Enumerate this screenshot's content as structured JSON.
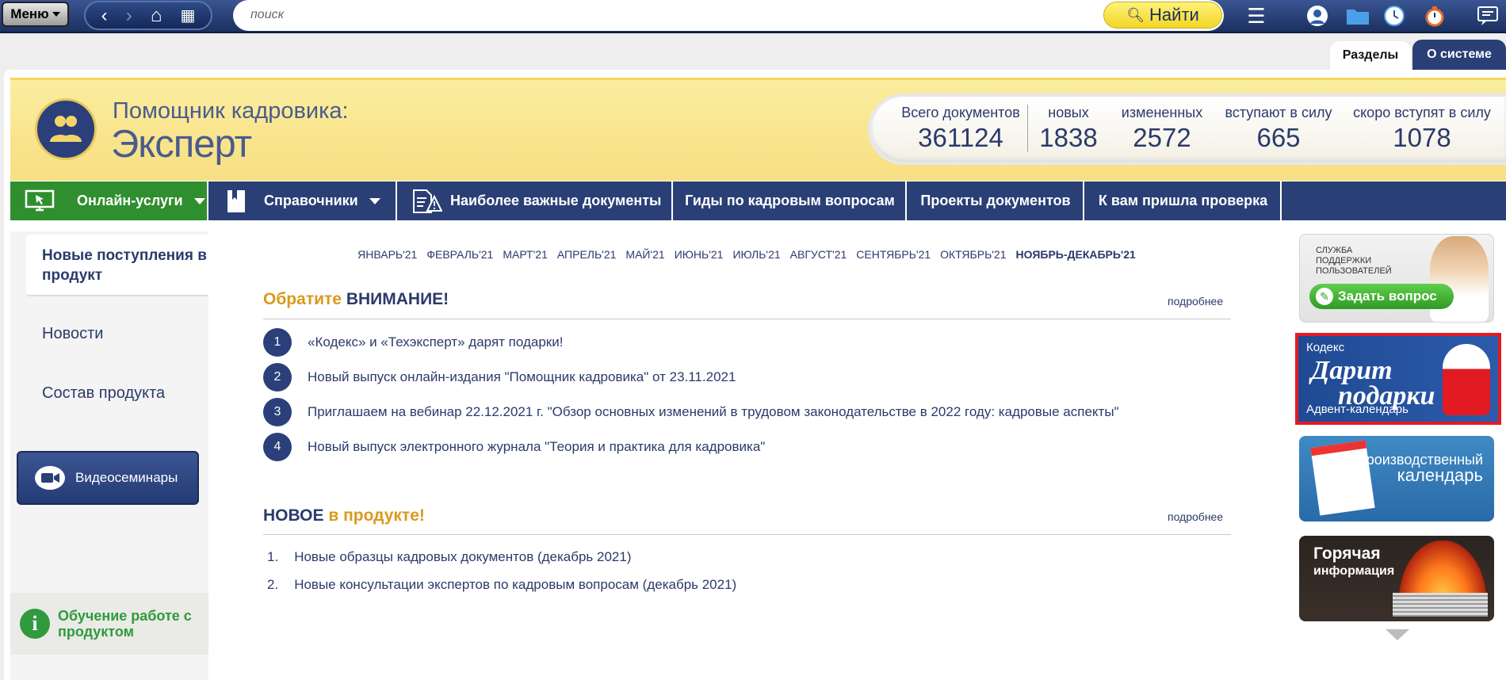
{
  "toolbar": {
    "menu_label": "Меню",
    "search_placeholder": "поиск",
    "find_label": "Найти",
    "icons": [
      "back-icon",
      "forward-icon",
      "home-icon",
      "grid-icon",
      "hamburger-icon",
      "user-icon",
      "folder-icon",
      "clock-icon",
      "stopwatch-icon",
      "comment-icon"
    ]
  },
  "tabs": {
    "sections": "Разделы",
    "about": "О системе"
  },
  "banner": {
    "title_line1": "Помощник кадровика:",
    "title_line2": "Эксперт",
    "stats": [
      {
        "label": "Всего документов",
        "value": "361124"
      },
      {
        "label": "новых",
        "value": "1838"
      },
      {
        "label": "измененных",
        "value": "2572"
      },
      {
        "label": "вступают в силу",
        "value": "665"
      },
      {
        "label": "скоро вступят в силу",
        "value": "1078"
      }
    ]
  },
  "nav": {
    "online": "Онлайн-услуги",
    "handbooks": "Справочники",
    "important": "Наиболее важные документы",
    "guides": "Гиды по кадровым вопросам",
    "projects": "Проекты документов",
    "inspection": "К вам пришла проверка",
    "colors": {
      "online": "#2f8f2e",
      "main": "#2a3f76"
    }
  },
  "sidebar": {
    "active": "Новые поступления в продукт",
    "news": "Новости",
    "composition": "Состав продукта",
    "video": "Видеосеминары",
    "training": "Обучение работе с продуктом"
  },
  "months": [
    "ЯНВАРЬ'21",
    "ФЕВРАЛЬ'21",
    "МАРТ'21",
    "АПРЕЛЬ'21",
    "МАЙ'21",
    "ИЮНЬ'21",
    "ИЮЛЬ'21",
    "АВГУСТ'21",
    "СЕНТЯБРЬ'21",
    "ОКТЯБРЬ'21",
    "НОЯБРЬ-ДЕКАБРЬ'21"
  ],
  "attention": {
    "title_a": "Обратите",
    "title_b": "ВНИМАНИЕ!",
    "more": "подробнее",
    "items": [
      {
        "n": "1",
        "text": "«Кодекс» и «Техэксперт» дарят подарки!"
      },
      {
        "n": "2",
        "text": "Новый выпуск онлайн-издания \"Помощник кадровика\" от 23.11.2021"
      },
      {
        "n": "3",
        "text": "Приглашаем на вебинар 22.12.2021 г. \"Обзор основных изменений в трудовом законодательстве в 2022 году: кадровые аспекты\""
      },
      {
        "n": "4",
        "text": "Новый выпуск электронного журнала \"Теория и практика для кадровика\""
      }
    ]
  },
  "newin": {
    "title_a": "НОВОЕ",
    "title_b": "в продукте!",
    "more": "подробнее",
    "items": [
      {
        "n": "1.",
        "text": "Новые образцы кадровых документов (декабрь 2021)"
      },
      {
        "n": "2.",
        "text": "Новые консультации экспертов по кадровым вопросам (декабрь 2021)"
      }
    ]
  },
  "right": {
    "support_text": "СЛУЖБА ПОДДЕРЖКИ ПОЛЬЗОВАТЕЛЕЙ",
    "ask": "Задать вопрос",
    "kodeks": "Кодекс",
    "gifts_1": "Дарит",
    "gifts_2": "подарки",
    "advent": "Адвент-календарь",
    "calendar_1": "Производственный",
    "calendar_2": "календарь",
    "hot_1": "Горячая",
    "hot_2": "информация"
  }
}
